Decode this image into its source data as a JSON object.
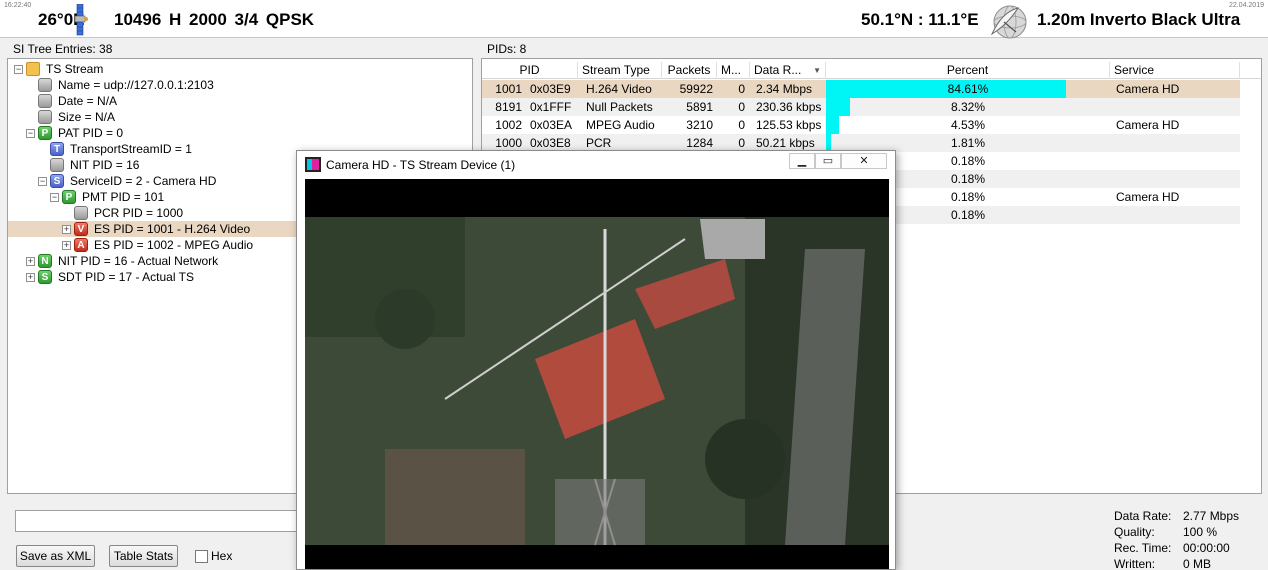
{
  "header": {
    "time": "16:22:40",
    "date": "22.04.2019",
    "position": "26°0E",
    "transponder": "10496 H 2000 3/4 QPSK",
    "location": "50.1°N : 11.1°E",
    "dish": "1.20m Inverto Black Ultra"
  },
  "tree": {
    "label": "SI Tree Entries: 38",
    "nodes": [
      {
        "text": "TS Stream",
        "icon": "folder-icon",
        "badge": "",
        "expander": "−",
        "selected": false
      },
      {
        "text": "Name = udp://127.0.0.1:2103",
        "icon": "grey-bullet-icon",
        "badge": "",
        "expander": "",
        "selected": false
      },
      {
        "text": "Date = N/A",
        "icon": "grey-bullet-icon",
        "badge": "",
        "expander": "",
        "selected": false
      },
      {
        "text": "Size = N/A",
        "icon": "grey-bullet-icon",
        "badge": "",
        "expander": "",
        "selected": false
      },
      {
        "text": "PAT PID = 0",
        "icon": "pat-badge-icon",
        "badge": "P",
        "expander": "−",
        "selected": false
      },
      {
        "text": "TransportStreamID = 1",
        "icon": "transport-badge-icon",
        "badge": "T",
        "expander": "",
        "selected": false
      },
      {
        "text": "NIT PID = 16",
        "icon": "grey-bullet-icon",
        "badge": "",
        "expander": "",
        "selected": false
      },
      {
        "text": "ServiceID = 2 - Camera HD",
        "icon": "service-badge-icon",
        "badge": "S",
        "expander": "−",
        "selected": false
      },
      {
        "text": "PMT PID = 101",
        "icon": "pmt-badge-icon",
        "badge": "P",
        "expander": "−",
        "selected": false
      },
      {
        "text": "PCR PID = 1000",
        "icon": "grey-bullet-icon",
        "badge": "",
        "expander": "",
        "selected": false
      },
      {
        "text": "ES PID = 1001 - H.264 Video",
        "icon": "video-badge-icon",
        "badge": "V",
        "expander": "+",
        "selected": true
      },
      {
        "text": "ES PID = 1002 - MPEG Audio",
        "icon": "audio-badge-icon",
        "badge": "A",
        "expander": "+",
        "selected": false
      },
      {
        "text": "NIT PID = 16 - Actual Network",
        "icon": "nit-badge-icon",
        "badge": "N",
        "expander": "+",
        "selected": false
      },
      {
        "text": "SDT PID = 17 - Actual TS",
        "icon": "sdt-badge-icon",
        "badge": "S",
        "expander": "+",
        "selected": false
      }
    ]
  },
  "pids": {
    "label": "PIDs: 8",
    "columns": [
      "PID",
      "Stream Type",
      "Packets",
      "M...",
      "Data R...",
      "Percent",
      "Service"
    ],
    "rows": [
      {
        "pid": "1001",
        "hex": "0x03E9",
        "type": "H.264 Video",
        "packets": "59922",
        "m": "0",
        "rate": "2.34 Mbps",
        "percent": "84.61%",
        "service": "Camera HD"
      },
      {
        "pid": "8191",
        "hex": "0x1FFF",
        "type": "Null Packets",
        "packets": "5891",
        "m": "0",
        "rate": "230.36 kbps",
        "percent": "8.32%",
        "service": ""
      },
      {
        "pid": "1002",
        "hex": "0x03EA",
        "type": "MPEG Audio",
        "packets": "3210",
        "m": "0",
        "rate": "125.53 kbps",
        "percent": "4.53%",
        "service": "Camera HD"
      },
      {
        "pid": "1000",
        "hex": "0x03E8",
        "type": "PCR",
        "packets": "1284",
        "m": "0",
        "rate": "50.21 kbps",
        "percent": "1.81%",
        "service": ""
      },
      {
        "pid": "",
        "hex": "",
        "type": "",
        "packets": "",
        "m": "",
        "rate": "",
        "percent": "0.18%",
        "service": ""
      },
      {
        "pid": "",
        "hex": "",
        "type": "",
        "packets": "",
        "m": "",
        "rate": "",
        "percent": "0.18%",
        "service": ""
      },
      {
        "pid": "",
        "hex": "",
        "type": "",
        "packets": "",
        "m": "",
        "rate": "",
        "percent": "0.18%",
        "service": "Camera HD"
      },
      {
        "pid": "",
        "hex": "",
        "type": "",
        "packets": "",
        "m": "",
        "rate": "",
        "percent": "0.18%",
        "service": ""
      }
    ]
  },
  "controls": {
    "save_xml": "Save as XML",
    "table_stats": "Table Stats",
    "hex": "Hex"
  },
  "status": {
    "data_rate_label": "Data Rate:",
    "data_rate": "2.77 Mbps",
    "quality_label": "Quality:",
    "quality": "100 %",
    "rec_time_label": "Rec. Time:",
    "rec_time": "00:00:00",
    "written_label": "Written:",
    "written": "0 MB"
  },
  "window": {
    "title": "Camera HD - TS Stream Device (1)"
  }
}
